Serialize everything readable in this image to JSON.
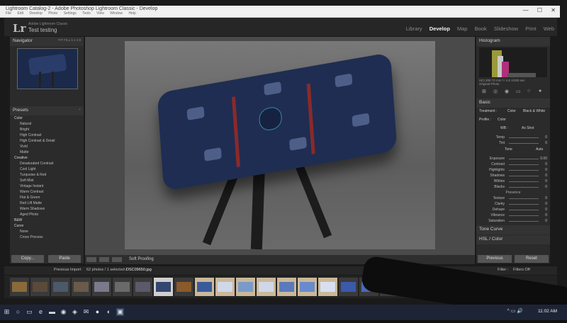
{
  "window": {
    "title": "Lightroom Catalog-2 - Adobe Photoshop Lightroom Classic - Develop",
    "menu": [
      "File",
      "Edit",
      "Develop",
      "Photo",
      "Settings",
      "Tools",
      "View",
      "Window",
      "Help"
    ],
    "controls": [
      "—",
      "☐",
      "✕"
    ]
  },
  "app": {
    "product": "Adobe Lightroom Classic",
    "catalog": "Test testing",
    "logo": "Lr",
    "modules": [
      "Library",
      "Develop",
      "Map",
      "Book",
      "Slideshow",
      "Print",
      "Web"
    ],
    "active_module": "Develop"
  },
  "left": {
    "navigator": {
      "label": "Navigator",
      "zoom": "FIT  FILL  1:1  1:8"
    },
    "presets": {
      "label": "Presets",
      "items": [
        "Color",
        "Natural",
        "Bright",
        "High Contrast",
        "High Contrast & Detail",
        "Vivid",
        "Matte",
        "Creative",
        "Desaturated Contrast",
        "Cool Light",
        "Turquoise & Red",
        "Soft Mist",
        "Vintage Instant",
        "Warm Contrast",
        "Flat & Green",
        "Red Lift Matte",
        "Warm Shadows",
        "Aged Photo",
        "B&W",
        "Curve",
        "None",
        "Cross Process"
      ]
    },
    "copy_label": "Copy...",
    "paste_label": "Paste"
  },
  "toolbar": {
    "soft_proofing": "Soft Proofing"
  },
  "right": {
    "histogram": {
      "label": "Histogram",
      "meta": "ISO 200    70 mm    f / 4.5    1/200 sec",
      "original_photo": "Original Photo"
    },
    "basic": {
      "label": "Basic",
      "treatment": "Treatment :",
      "color": "Color",
      "bw": "Black & White",
      "profile": "Profile :",
      "profile_value": "Color",
      "wb": "WB :",
      "wb_value": "As Shot",
      "tone": "Tone",
      "auto": "Auto",
      "presence": "Presence",
      "rows": [
        {
          "label": "Temp",
          "value": "0"
        },
        {
          "label": "Tint",
          "value": "0"
        },
        {
          "label": "Exposure",
          "value": "0.00"
        },
        {
          "label": "Contrast",
          "value": "0"
        },
        {
          "label": "Highlights",
          "value": "0"
        },
        {
          "label": "Shadows",
          "value": "0"
        },
        {
          "label": "Whites",
          "value": "0"
        },
        {
          "label": "Blacks",
          "value": "0"
        },
        {
          "label": "Texture",
          "value": "0"
        },
        {
          "label": "Clarity",
          "value": "0"
        },
        {
          "label": "Dehaze",
          "value": "0"
        },
        {
          "label": "Vibrance",
          "value": "0"
        },
        {
          "label": "Saturation",
          "value": "0"
        }
      ]
    },
    "tone_curve": "Tone Curve",
    "hsl": "HSL / Color",
    "previous_label": "Previous",
    "reset_label": "Reset"
  },
  "filmstrip": {
    "source": "Previous Import",
    "count": "62 photos / 1 selected /",
    "filename": "DSC09650.jpg",
    "filter_label": "Filter :",
    "filter_value": "Filters Off"
  },
  "taskbar": {
    "time": "11:02 AM",
    "tray": "^  ▭  🔊"
  },
  "colors": {
    "accent": "#f2f2f2",
    "panel": "#2b2b2b",
    "tray_blue": "#1f2d52"
  }
}
